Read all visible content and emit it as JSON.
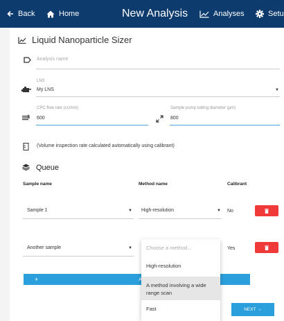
{
  "topbar": {
    "back_label": "Back",
    "home_label": "Home",
    "title": "New Analysis",
    "analyses_label": "Analyses",
    "setup_label": "Setu"
  },
  "form": {
    "heading": "Liquid Nanoparticle Sizer",
    "analysis_name_placeholder": "Analysis name",
    "lns_label": "LNS",
    "lns_value": "My LNS",
    "cpc_label": "CPC flow rate (cc/min)",
    "cpc_value": "600",
    "tubing_label": "Sample pump tubing diameter (μm)",
    "tubing_value": "800",
    "note": "(Volume inspection rate calculated automatically using calibrant)"
  },
  "queue": {
    "title": "Queue",
    "columns": {
      "sample": "Sample name",
      "method": "Method name",
      "calibrant": "Calibrant"
    },
    "rows": [
      {
        "sample": "Sample 1",
        "method": "High-resolution",
        "calibrant": "No"
      },
      {
        "sample": "Another sample",
        "method": "",
        "calibrant": "Yes"
      }
    ],
    "add_label": "+",
    "add_text_fragment": "A"
  },
  "dropdown": {
    "placeholder": "Choose a method...",
    "options": [
      "High-resolution",
      "A method involving a wide range scan",
      "Fast"
    ],
    "highlighted_index": 1
  },
  "footer": {
    "next_label": "NEXT →"
  },
  "colors": {
    "topbar": "#0d3b6e",
    "accent": "#2b9fdb",
    "delete": "#f03a3a"
  }
}
